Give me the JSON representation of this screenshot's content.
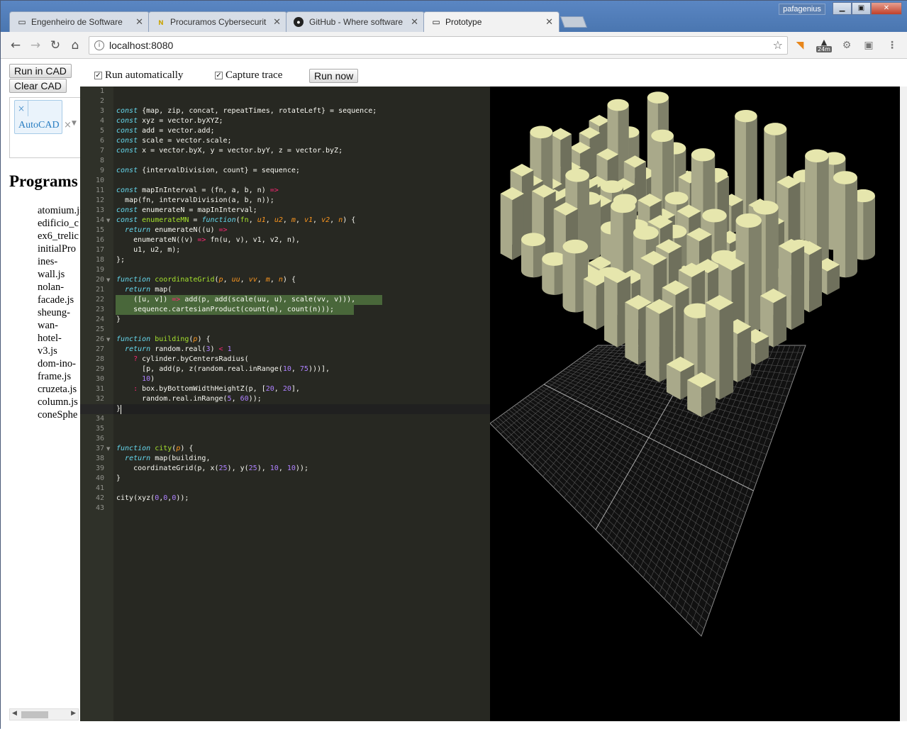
{
  "browser": {
    "tabs": [
      {
        "title": "Engenheiro de Software",
        "icon": "document-icon"
      },
      {
        "title": "Procuramos Cybersecurit",
        "icon": "nu-logo-icon"
      },
      {
        "title": "GitHub - Where software",
        "icon": "github-icon"
      },
      {
        "title": "Prototype",
        "icon": "document-icon"
      }
    ],
    "user": "pafagenius",
    "url": "localhost:8080",
    "extension_badge": "24m"
  },
  "controls": {
    "run_in_cad": "Run in CAD",
    "clear_cad": "Clear CAD",
    "run_automatically": "Run automatically",
    "capture_trace": "Capture trace",
    "run_now": "Run now",
    "run_automatically_checked": true,
    "capture_trace_checked": true
  },
  "cad_select": {
    "selected": "AutoCAD",
    "remove_glyph": "×",
    "clear_glyph": "×"
  },
  "programs": {
    "title": "Programs",
    "items": [
      "atomium.js",
      "edificio_c",
      "ex6_trelic",
      "initialPro",
      "ines-",
      "wall.js",
      "nolan-",
      "facade.js",
      "sheung-",
      "wan-",
      "hotel-",
      "v3.js",
      "dom-ino-",
      "frame.js",
      "cruzeta.js",
      "column.js",
      "coneSphe"
    ]
  },
  "editor": {
    "line_count": 43,
    "active_line": 33,
    "highlighted_lines": [
      22,
      23
    ],
    "fold_lines": [
      14,
      20,
      26,
      37
    ],
    "lines": [
      "",
      "",
      "const {map, zip, concat, repeatTimes, rotateLeft} = sequence;",
      "const xyz = vector.byXYZ;",
      "const add = vector.add;",
      "const scale = vector.scale;",
      "const x = vector.byX, y = vector.byY, z = vector.byZ;",
      "",
      "const {intervalDivision, count} = sequence;",
      "",
      "const mapInInterval = (fn, a, b, n) =>",
      "  map(fn, intervalDivision(a, b, n));",
      "const enumerateN = mapInInterval;",
      "const enumerateMN = function(fn, u1, u2, m, v1, v2, n) {",
      "  return enumerateN((u) =>",
      "    enumerateN((v) => fn(u, v), v1, v2, n),",
      "    u1, u2, m);",
      "};",
      "",
      "function coordinateGrid(p, uu, vv, m, n) {",
      "  return map(",
      "    ([u, v]) => add(p, add(scale(uu, u), scale(vv, v))),",
      "    sequence.cartesianProduct(count(m), count(n)));",
      "}",
      "",
      "function building(p) {",
      "  return random.real(3) < 1",
      "    ? cylinder.byCentersRadius(",
      "      [p, add(p, z(random.real.inRange(10, 75)))],",
      "      10)",
      "    : box.byBottomWidthHeightZ(p, [20, 20],",
      "      random.real.inRange(5, 60));",
      "}",
      "",
      "",
      "",
      "function city(p) {",
      "  return map(building,",
      "    coordinateGrid(p, x(25), y(25), 10, 10));",
      "}",
      "",
      "city(xyz(0,0,0));",
      ""
    ]
  },
  "scene": {
    "building_color": "#e6e6ad",
    "side_light": "#a9a98a",
    "side_dark": "#6f705c",
    "grid_color": "#8a8a8a",
    "background": "#000000"
  }
}
